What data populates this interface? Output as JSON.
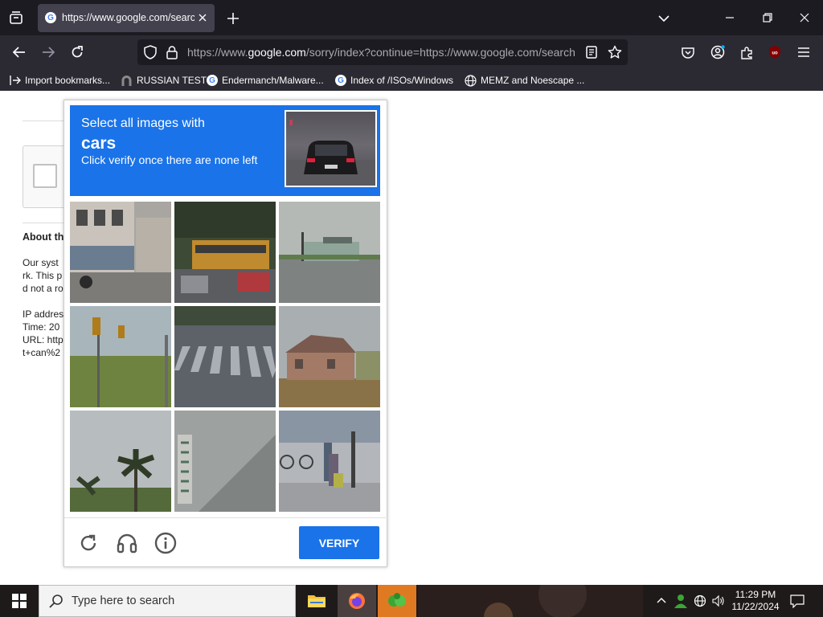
{
  "browser": {
    "tab": {
      "title": "https://www.google.com/search"
    },
    "url_host": "https://www.",
    "url_domain": "google.com",
    "url_rest": "/sorry/index?continue=https://www.google.com/search",
    "bookmarks": [
      {
        "label": "Import bookmarks...",
        "icon": "import-icon"
      },
      {
        "label": "RUSSIAN TEST",
        "icon": "horseshoe-icon"
      },
      {
        "label": "Endermanch/Malware...",
        "icon": "google-icon"
      },
      {
        "label": "Index of /ISOs/Windows",
        "icon": "google-icon"
      },
      {
        "label": "MEMZ and Noescape ...",
        "icon": "globe-icon"
      }
    ]
  },
  "page": {
    "heading": "About th",
    "lines": [
      "Our syst",
      "rk. This p",
      "d not a ro"
    ],
    "info": [
      "IP addres",
      "Time: 20",
      "URL: http",
      "t+can%2"
    ]
  },
  "captcha": {
    "instruction": "Select all images with",
    "target": "cars",
    "subtext": "Click verify once there are none left",
    "verify_label": "VERIFY",
    "tiles": [
      "street-storefront",
      "yellow-bus-traffic",
      "gas-station-road",
      "traffic-lights-hill",
      "crosswalk",
      "brick-house",
      "palm-trees",
      "building-roof",
      "people-sidewalk"
    ]
  },
  "taskbar": {
    "search_placeholder": "Type here to search",
    "time": "11:29 PM",
    "date": "11/22/2024"
  },
  "colors": {
    "accent": "#1a73e8",
    "chrome_dark": "#1c1b22",
    "toolbar": "#2b2a33"
  }
}
